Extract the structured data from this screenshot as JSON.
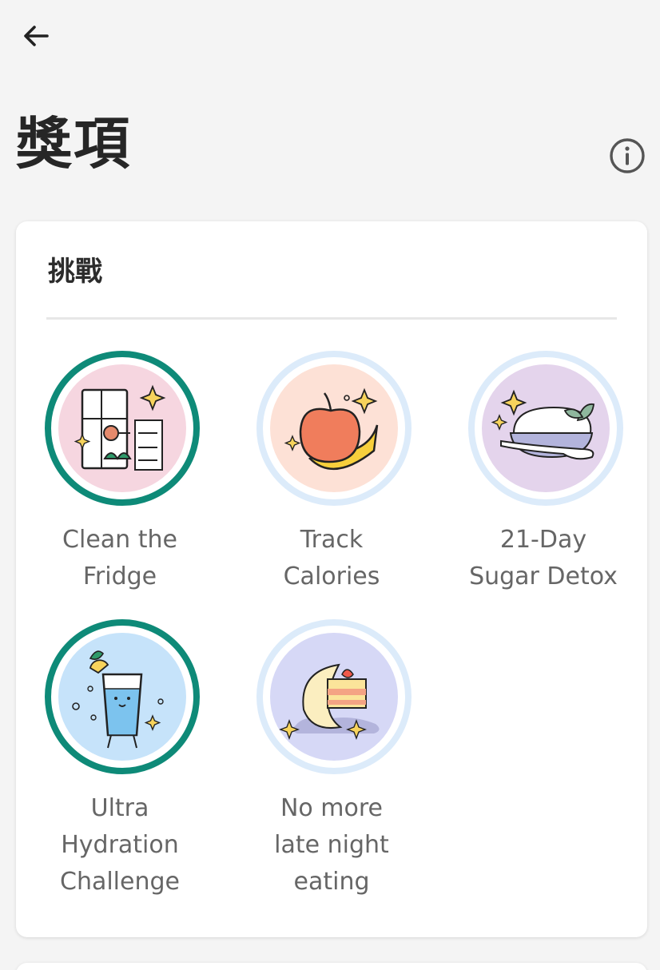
{
  "header": {
    "back_icon": "arrow-left-icon",
    "title": "獎項",
    "info_icon": "info-circle-icon"
  },
  "challenges": {
    "section_title": "挑戰",
    "items": [
      {
        "label_line1": "Clean the",
        "label_line2": "Fridge",
        "label_line3": "",
        "completed": true,
        "icon": "fridge-icon",
        "bg": "#f6d6e0"
      },
      {
        "label_line1": "Track",
        "label_line2": "Calories",
        "label_line3": "",
        "completed": false,
        "icon": "apple-banana-icon",
        "bg": "#fde1d6"
      },
      {
        "label_line1": "21-Day",
        "label_line2": "Sugar Detox",
        "label_line3": "",
        "completed": false,
        "icon": "sugar-bowl-icon",
        "bg": "#e4d4ec"
      },
      {
        "label_line1": "Ultra",
        "label_line2": "Hydration",
        "label_line3": "Challenge",
        "completed": true,
        "icon": "water-glass-icon",
        "bg": "#c6e3fa"
      },
      {
        "label_line1": "No more",
        "label_line2": "late night",
        "label_line3": "eating",
        "completed": false,
        "icon": "moon-cake-icon",
        "bg": "#d6d8f6"
      }
    ]
  },
  "colors": {
    "completed_ring": "#0e8a78",
    "incomplete_ring": "#dcebfa",
    "sparkle": "#f7d35c"
  }
}
